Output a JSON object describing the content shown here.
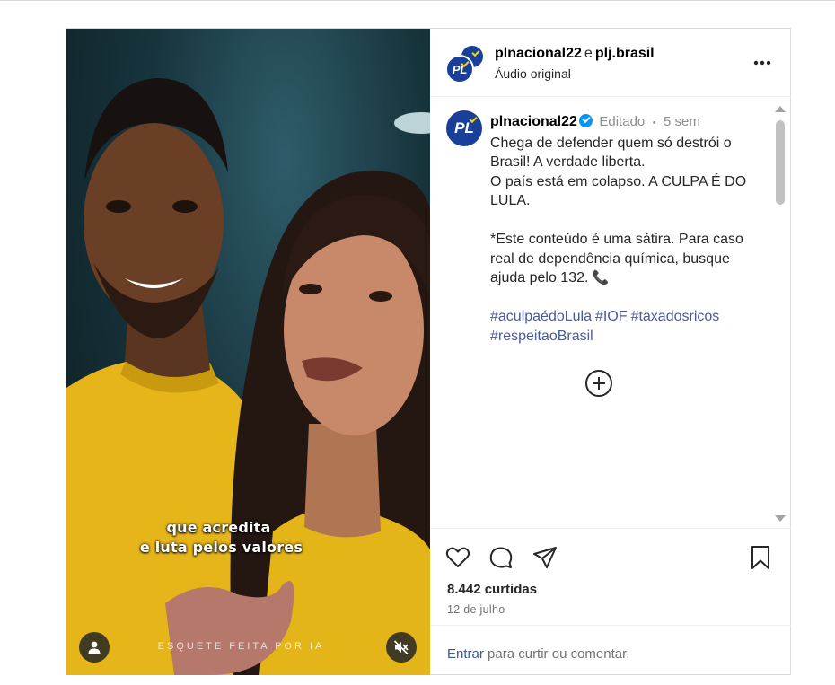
{
  "post": {
    "authors": {
      "primary": "plnacional22",
      "joiner": "e",
      "secondary": "plj.brasil"
    },
    "audio": "Áudio original",
    "more_label": "•••",
    "avatar_label": "PL",
    "caption": {
      "username": "plnacional22",
      "edited": "Editado",
      "dot": "•",
      "time": "5 sem",
      "line1": "Chega de defender quem só destrói o Brasil! A verdade liberta.",
      "line2": "O país está em colapso. A CULPA É DO LULA.",
      "line3": "*Este conteúdo é uma sátira. Para caso real de dependência química, busque ajuda pelo 132.",
      "phone_emoji": "📞",
      "hashtags": [
        "#aculpaédoLula",
        "#IOF",
        "#taxadosricos",
        "#respeitaoBrasil"
      ]
    },
    "likes": "8.442 curtidas",
    "date": "12 de julho",
    "login_link": "Entrar",
    "login_rest": "para curtir ou comentar."
  },
  "video": {
    "subtitle_line1": "que acredita",
    "subtitle_line2": "e luta pelos valores",
    "watermark": "ESQUETE FEITA POR IA"
  },
  "colors": {
    "brand_blue": "#1a3f9b",
    "brand_yellow": "#f5d20a",
    "verified_blue": "#0095f6",
    "hashtag": "#4a5a9a",
    "link": "#385898",
    "phone_pink": "#e1306c"
  },
  "icons": {
    "like": "heart-icon",
    "comment": "comment-bubble-icon",
    "share": "paper-plane-icon",
    "save": "bookmark-icon",
    "add_comment": "plus-circle-icon",
    "user": "user-icon",
    "mute": "speaker-muted-icon"
  }
}
